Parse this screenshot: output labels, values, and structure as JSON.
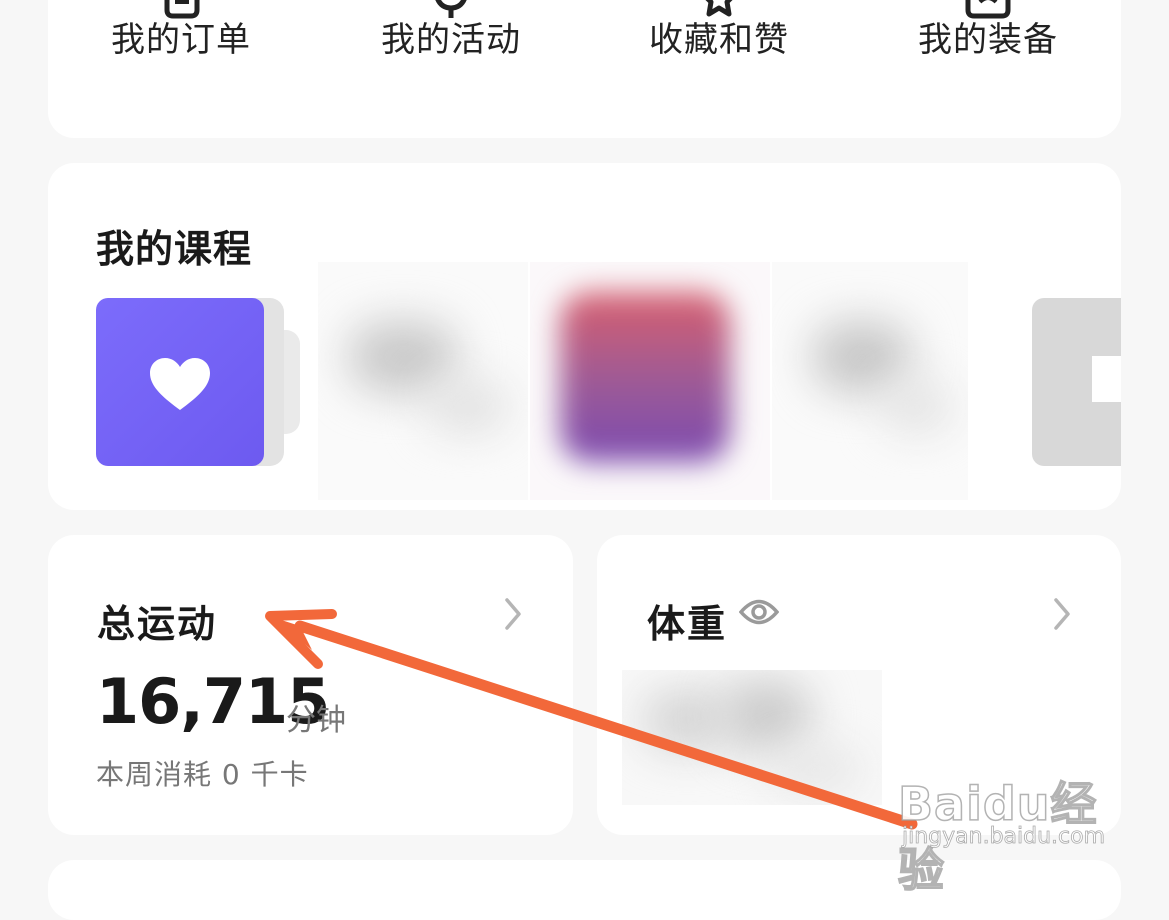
{
  "shortcuts": [
    {
      "label": "我的订单",
      "icon": "order-icon"
    },
    {
      "label": "我的活动",
      "icon": "activity-icon"
    },
    {
      "label": "收藏和赞",
      "icon": "star-icon"
    },
    {
      "label": "我的装备",
      "icon": "equipment-icon"
    }
  ],
  "courses": {
    "title": "我的课程",
    "favorite_icon": "heart-icon"
  },
  "exercise": {
    "title": "总运动",
    "value": "16,715",
    "unit": "分钟",
    "weekly": "本周消耗 0 千卡"
  },
  "weight": {
    "title": "体重",
    "visibility_icon": "eye-icon"
  },
  "watermark": {
    "logo": "Baidu经验",
    "url": "jingyan.baidu.com"
  },
  "colors": {
    "background": "#f7f7f7",
    "card": "#ffffff",
    "course_accent": "#7c6cfb",
    "arrow": "#f2683a"
  }
}
